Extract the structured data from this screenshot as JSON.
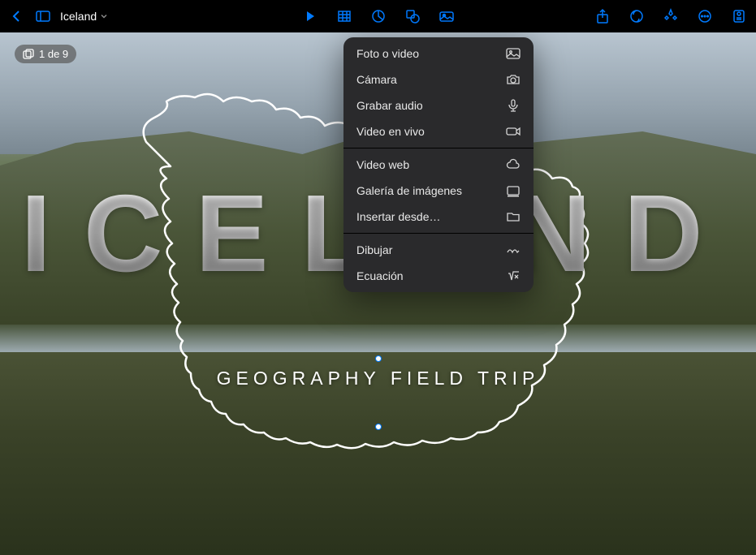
{
  "toolbar": {
    "doc_title": "Iceland",
    "accent_color": "#007aff"
  },
  "slide_counter": "1 de 9",
  "slide": {
    "main_title": "ICELAND",
    "subtitle": "GEOGRAPHY FIELD TRIP"
  },
  "insert_menu": {
    "groups": [
      {
        "items": [
          {
            "label": "Foto o video",
            "icon": "photo-landscape"
          },
          {
            "label": "Cámara",
            "icon": "camera"
          },
          {
            "label": "Grabar audio",
            "icon": "microphone"
          },
          {
            "label": "Video en vivo",
            "icon": "video-live"
          }
        ]
      },
      {
        "items": [
          {
            "label": "Video web",
            "icon": "cloud"
          },
          {
            "label": "Galería de imágenes",
            "icon": "gallery"
          },
          {
            "label": "Insertar desde…",
            "icon": "folder"
          }
        ]
      },
      {
        "items": [
          {
            "label": "Dibujar",
            "icon": "scribble"
          },
          {
            "label": "Ecuación",
            "icon": "equation"
          }
        ]
      }
    ]
  }
}
